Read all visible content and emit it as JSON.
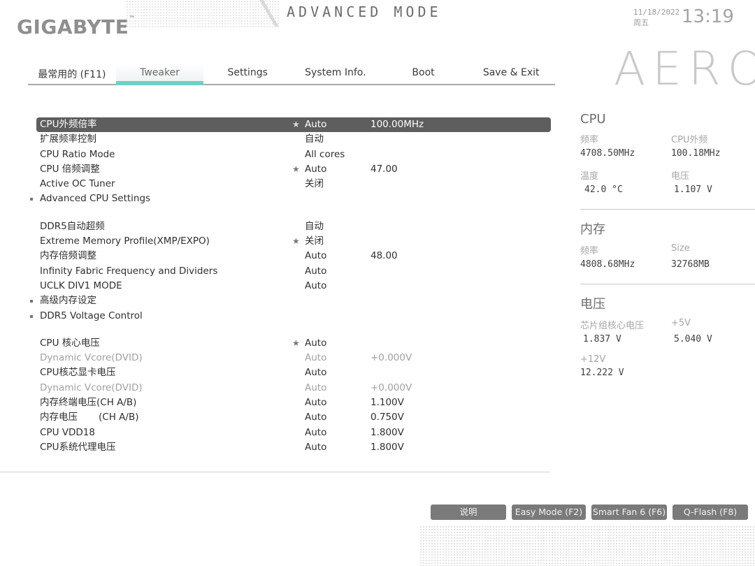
{
  "header": {
    "logo": "GIGABYTE",
    "logo_mark": "™",
    "mode": "ADVANCED MODE",
    "date": "11/18/2022",
    "weekday": "周五",
    "time": "13:19",
    "brand": "AERO"
  },
  "tabs": [
    {
      "label": "最常用的 (F11)"
    },
    {
      "label": "Tweaker"
    },
    {
      "label": "Settings"
    },
    {
      "label": "System Info."
    },
    {
      "label": "Boot"
    },
    {
      "label": "Save & Exit"
    }
  ],
  "settings": {
    "group1": [
      {
        "label": "CPU外频倍率",
        "star": "★",
        "value": "Auto",
        "value2": "100.00MHz"
      },
      {
        "label": "扩展频率控制",
        "star": "",
        "value": "自动",
        "value2": ""
      },
      {
        "label": "CPU Ratio Mode",
        "star": "",
        "value": "All cores",
        "value2": ""
      },
      {
        "label": "CPU 倍频调整",
        "star": "★",
        "value": "Auto",
        "value2": "47.00"
      },
      {
        "label": "Active OC Tuner",
        "star": "",
        "value": "关闭",
        "value2": ""
      },
      {
        "label": "Advanced CPU Settings",
        "star": "",
        "value": "",
        "value2": ""
      }
    ],
    "group2": [
      {
        "label": "DDR5自动超频",
        "star": "",
        "value": "自动",
        "value2": ""
      },
      {
        "label": "Extreme Memory Profile(XMP/EXPO)",
        "star": "★",
        "value": "关闭",
        "value2": ""
      },
      {
        "label": "内存倍频调整",
        "star": "",
        "value": "Auto",
        "value2": "48.00"
      },
      {
        "label": "Infinity Fabric Frequency and Dividers",
        "star": "",
        "value": "Auto",
        "value2": ""
      },
      {
        "label": "UCLK DIV1 MODE",
        "star": "",
        "value": "Auto",
        "value2": ""
      },
      {
        "label": "高级内存设定",
        "star": "",
        "value": "",
        "value2": ""
      },
      {
        "label": "DDR5 Voltage Control",
        "star": "",
        "value": "",
        "value2": ""
      }
    ],
    "group3": [
      {
        "label": "CPU 核心电压",
        "star": "★",
        "value": "Auto",
        "value2": ""
      },
      {
        "label": "Dynamic Vcore(DVID)",
        "star": "",
        "value": "Auto",
        "value2": "+0.000V"
      },
      {
        "label": "CPU核芯显卡电压",
        "star": "",
        "value": "Auto",
        "value2": ""
      },
      {
        "label": "Dynamic Vcore(DVID)",
        "star": "",
        "value": "Auto",
        "value2": "+0.000V"
      },
      {
        "label": "内存终端电压(CH A/B)",
        "star": "",
        "value": "Auto",
        "value2": "1.100V"
      },
      {
        "label": "内存电压       (CH A/B)",
        "star": "",
        "value": "Auto",
        "value2": "0.750V"
      },
      {
        "label": "CPU VDD18",
        "star": "",
        "value": "Auto",
        "value2": "1.800V"
      },
      {
        "label": "CPU系统代理电压",
        "star": "",
        "value": "Auto",
        "value2": "1.800V"
      }
    ]
  },
  "monitor": {
    "cpu": {
      "title": "CPU",
      "freq_label": "频率",
      "bclk_label": "CPU外频",
      "freq": "4708.50MHz",
      "bclk": "100.18MHz",
      "temp_label": "温度",
      "volt_label": "电压",
      "temp": "42.0 °C",
      "volt": "1.107 V"
    },
    "memory": {
      "title": "内存",
      "freq_label": "频率",
      "size_label": "Size",
      "freq": "4808.68MHz",
      "size": "32768MB"
    },
    "voltage": {
      "title": "电压",
      "chipset_label": "芯片组核心电压",
      "p5v_label": "+5V",
      "chipset": "1.837 V",
      "p5v": "5.040 V",
      "p12v_label": "+12V",
      "p12v": "12.222 V"
    }
  },
  "footer": {
    "help": "说明",
    "easy_mode": "Easy Mode (F2)",
    "smart_fan": "Smart Fan 6 (F6)",
    "qflash": "Q-Flash (F8)"
  }
}
